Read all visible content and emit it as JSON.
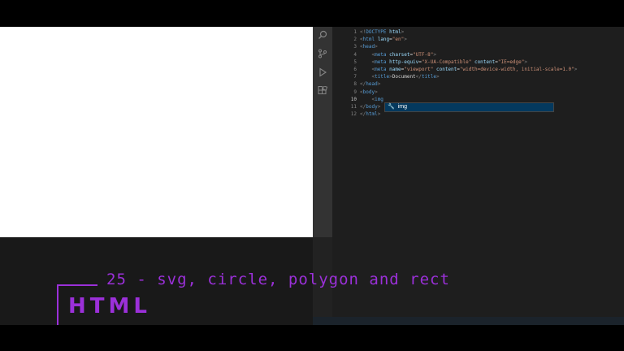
{
  "editor": {
    "line_numbers": [
      "1",
      "2",
      "3",
      "4",
      "5",
      "6",
      "7",
      "8",
      "9",
      "10",
      "11",
      "12"
    ],
    "lines": [
      {
        "indent": "",
        "tokens": [
          {
            "t": "br",
            "v": "<!"
          },
          {
            "t": "tag",
            "v": "DOCTYPE"
          },
          {
            "t": "txt",
            "v": " "
          },
          {
            "t": "attr",
            "v": "html"
          },
          {
            "t": "br",
            "v": ">"
          }
        ]
      },
      {
        "indent": "",
        "tokens": [
          {
            "t": "br",
            "v": "<"
          },
          {
            "t": "tag",
            "v": "html"
          },
          {
            "t": "txt",
            "v": " "
          },
          {
            "t": "attr",
            "v": "lang"
          },
          {
            "t": "txt",
            "v": "="
          },
          {
            "t": "str",
            "v": "\"en\""
          },
          {
            "t": "br",
            "v": ">"
          }
        ]
      },
      {
        "indent": "",
        "tokens": [
          {
            "t": "br",
            "v": "<"
          },
          {
            "t": "tag",
            "v": "head"
          },
          {
            "t": "br",
            "v": ">"
          }
        ]
      },
      {
        "indent": "    ",
        "tokens": [
          {
            "t": "br",
            "v": "<"
          },
          {
            "t": "tag",
            "v": "meta"
          },
          {
            "t": "txt",
            "v": " "
          },
          {
            "t": "attr",
            "v": "charset"
          },
          {
            "t": "txt",
            "v": "="
          },
          {
            "t": "str",
            "v": "\"UTF-8\""
          },
          {
            "t": "br",
            "v": ">"
          }
        ]
      },
      {
        "indent": "    ",
        "tokens": [
          {
            "t": "br",
            "v": "<"
          },
          {
            "t": "tag",
            "v": "meta"
          },
          {
            "t": "txt",
            "v": " "
          },
          {
            "t": "attr",
            "v": "http-equiv"
          },
          {
            "t": "txt",
            "v": "="
          },
          {
            "t": "str",
            "v": "\"X-UA-Compatible\""
          },
          {
            "t": "txt",
            "v": " "
          },
          {
            "t": "attr",
            "v": "content"
          },
          {
            "t": "txt",
            "v": "="
          },
          {
            "t": "str",
            "v": "\"IE=edge\""
          },
          {
            "t": "br",
            "v": ">"
          }
        ]
      },
      {
        "indent": "    ",
        "tokens": [
          {
            "t": "br",
            "v": "<"
          },
          {
            "t": "tag",
            "v": "meta"
          },
          {
            "t": "txt",
            "v": " "
          },
          {
            "t": "attr",
            "v": "name"
          },
          {
            "t": "txt",
            "v": "="
          },
          {
            "t": "str",
            "v": "\"viewport\""
          },
          {
            "t": "txt",
            "v": " "
          },
          {
            "t": "attr",
            "v": "content"
          },
          {
            "t": "txt",
            "v": "="
          },
          {
            "t": "str",
            "v": "\"width=device-width, initial-scale=1.0\""
          },
          {
            "t": "br",
            "v": ">"
          }
        ]
      },
      {
        "indent": "    ",
        "tokens": [
          {
            "t": "br",
            "v": "<"
          },
          {
            "t": "tag",
            "v": "title"
          },
          {
            "t": "br",
            "v": ">"
          },
          {
            "t": "txt",
            "v": "Document"
          },
          {
            "t": "br",
            "v": "</"
          },
          {
            "t": "tag",
            "v": "title"
          },
          {
            "t": "br",
            "v": ">"
          }
        ]
      },
      {
        "indent": "",
        "tokens": [
          {
            "t": "br",
            "v": "</"
          },
          {
            "t": "tag",
            "v": "head"
          },
          {
            "t": "br",
            "v": ">"
          }
        ]
      },
      {
        "indent": "",
        "tokens": [
          {
            "t": "br",
            "v": "<"
          },
          {
            "t": "tag",
            "v": "body"
          },
          {
            "t": "br",
            "v": ">"
          }
        ]
      },
      {
        "indent": "    ",
        "tokens": [
          {
            "t": "br",
            "v": "<"
          },
          {
            "t": "tag",
            "v": "img"
          }
        ]
      },
      {
        "indent": "",
        "tokens": [
          {
            "t": "br",
            "v": "</"
          },
          {
            "t": "tag",
            "v": "body"
          },
          {
            "t": "br",
            "v": ">"
          }
        ]
      },
      {
        "indent": "",
        "tokens": [
          {
            "t": "br",
            "v": "</"
          },
          {
            "t": "tag",
            "v": "html"
          },
          {
            "t": "br",
            "v": ">"
          }
        ]
      }
    ],
    "active_line": 10,
    "suggestion": "img",
    "activity_icons": [
      "search-icon",
      "source-control-icon",
      "debug-icon",
      "extensions-icon"
    ]
  },
  "overlay": {
    "subtitle": "25 - svg, circle, polygon and rect",
    "badge": "HTML"
  },
  "colors": {
    "accent": "#9b30d9",
    "editor_bg": "#1e1e1e",
    "tag": "#569cd6",
    "attr": "#9cdcfe",
    "string": "#ce9178"
  }
}
